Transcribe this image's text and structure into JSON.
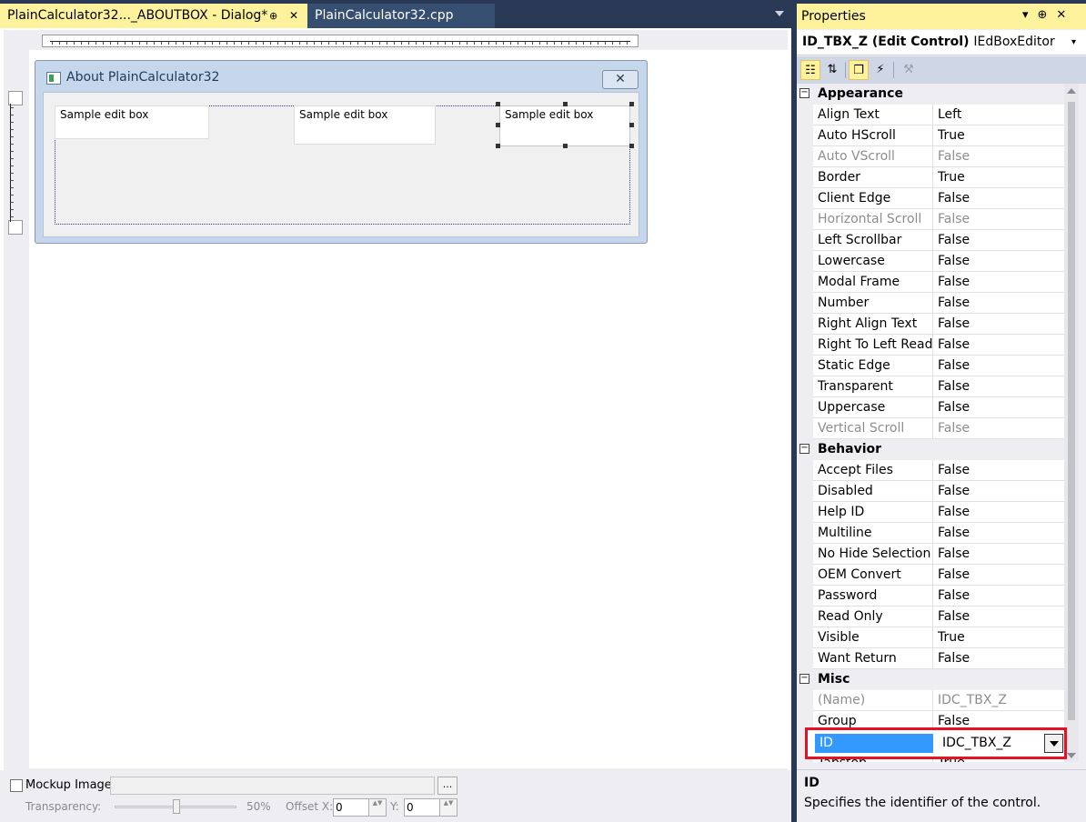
{
  "tabs": {
    "dialog": {
      "label": "PlainCalculator32..._ABOUTBOX - Dialog*",
      "pin": "⊕",
      "close": "✕"
    },
    "cpp": {
      "label": "PlainCalculator32.cpp"
    }
  },
  "dialog": {
    "title": "About PlainCalculator32",
    "close": "✕",
    "editboxes": [
      "Sample edit box",
      "Sample edit box",
      "Sample edit box"
    ]
  },
  "bottom": {
    "mockup_label": "Mockup Image:",
    "browse": "...",
    "transparency_label": "Transparency:",
    "transparency_value": "50%",
    "transparency_level": 0.5,
    "offset_x_label": "Offset X:",
    "offset_x": "0",
    "offset_y_label": "Y:",
    "offset_y": "0",
    "spin": "▲▼"
  },
  "properties": {
    "title": "Properties",
    "title_controls": "▾⊕✕",
    "object_name": "ID_TBX_Z (Edit Control)",
    "object_type": "IEdBoxEditor",
    "dropdown": "▾",
    "toolbar": {
      "categorized": "☷",
      "alphabetical": "⇅",
      "properties": "❐",
      "events": "⚡",
      "property_pages": "⚒"
    },
    "categories": [
      {
        "name": "Appearance",
        "toggle": "−",
        "rows": [
          {
            "name": "Align Text",
            "value": "Left"
          },
          {
            "name": "Auto HScroll",
            "value": "True"
          },
          {
            "name": "Auto VScroll",
            "value": "False",
            "dim": true
          },
          {
            "name": "Border",
            "value": "True"
          },
          {
            "name": "Client Edge",
            "value": "False"
          },
          {
            "name": "Horizontal Scroll",
            "value": "False",
            "dim": true
          },
          {
            "name": "Left Scrollbar",
            "value": "False"
          },
          {
            "name": "Lowercase",
            "value": "False"
          },
          {
            "name": "Modal Frame",
            "value": "False"
          },
          {
            "name": "Number",
            "value": "False"
          },
          {
            "name": "Right Align Text",
            "value": "False"
          },
          {
            "name": "Right To Left Readi",
            "value": "False"
          },
          {
            "name": "Static Edge",
            "value": "False"
          },
          {
            "name": "Transparent",
            "value": "False"
          },
          {
            "name": "Uppercase",
            "value": "False"
          },
          {
            "name": "Vertical Scroll",
            "value": "False",
            "dim": true
          }
        ]
      },
      {
        "name": "Behavior",
        "toggle": "−",
        "rows": [
          {
            "name": "Accept Files",
            "value": "False"
          },
          {
            "name": "Disabled",
            "value": "False"
          },
          {
            "name": "Help ID",
            "value": "False"
          },
          {
            "name": "Multiline",
            "value": "False"
          },
          {
            "name": "No Hide Selection",
            "value": "False"
          },
          {
            "name": "OEM Convert",
            "value": "False"
          },
          {
            "name": "Password",
            "value": "False"
          },
          {
            "name": "Read Only",
            "value": "False"
          },
          {
            "name": "Visible",
            "value": "True"
          },
          {
            "name": "Want Return",
            "value": "False"
          }
        ]
      },
      {
        "name": "Misc",
        "toggle": "−",
        "rows": [
          {
            "name": "(Name)",
            "value": "IDC_TBX_Z",
            "dim": true
          },
          {
            "name": "Group",
            "value": "False"
          },
          {
            "name": "ID",
            "value": "IDC_TBX_Z"
          },
          {
            "name": "Tabstop",
            "value": "True"
          }
        ]
      }
    ],
    "selected": {
      "name": "ID",
      "value": "IDC_TBX_Z"
    },
    "description": {
      "title": "ID",
      "text": "Specifies the identifier of the control."
    }
  }
}
